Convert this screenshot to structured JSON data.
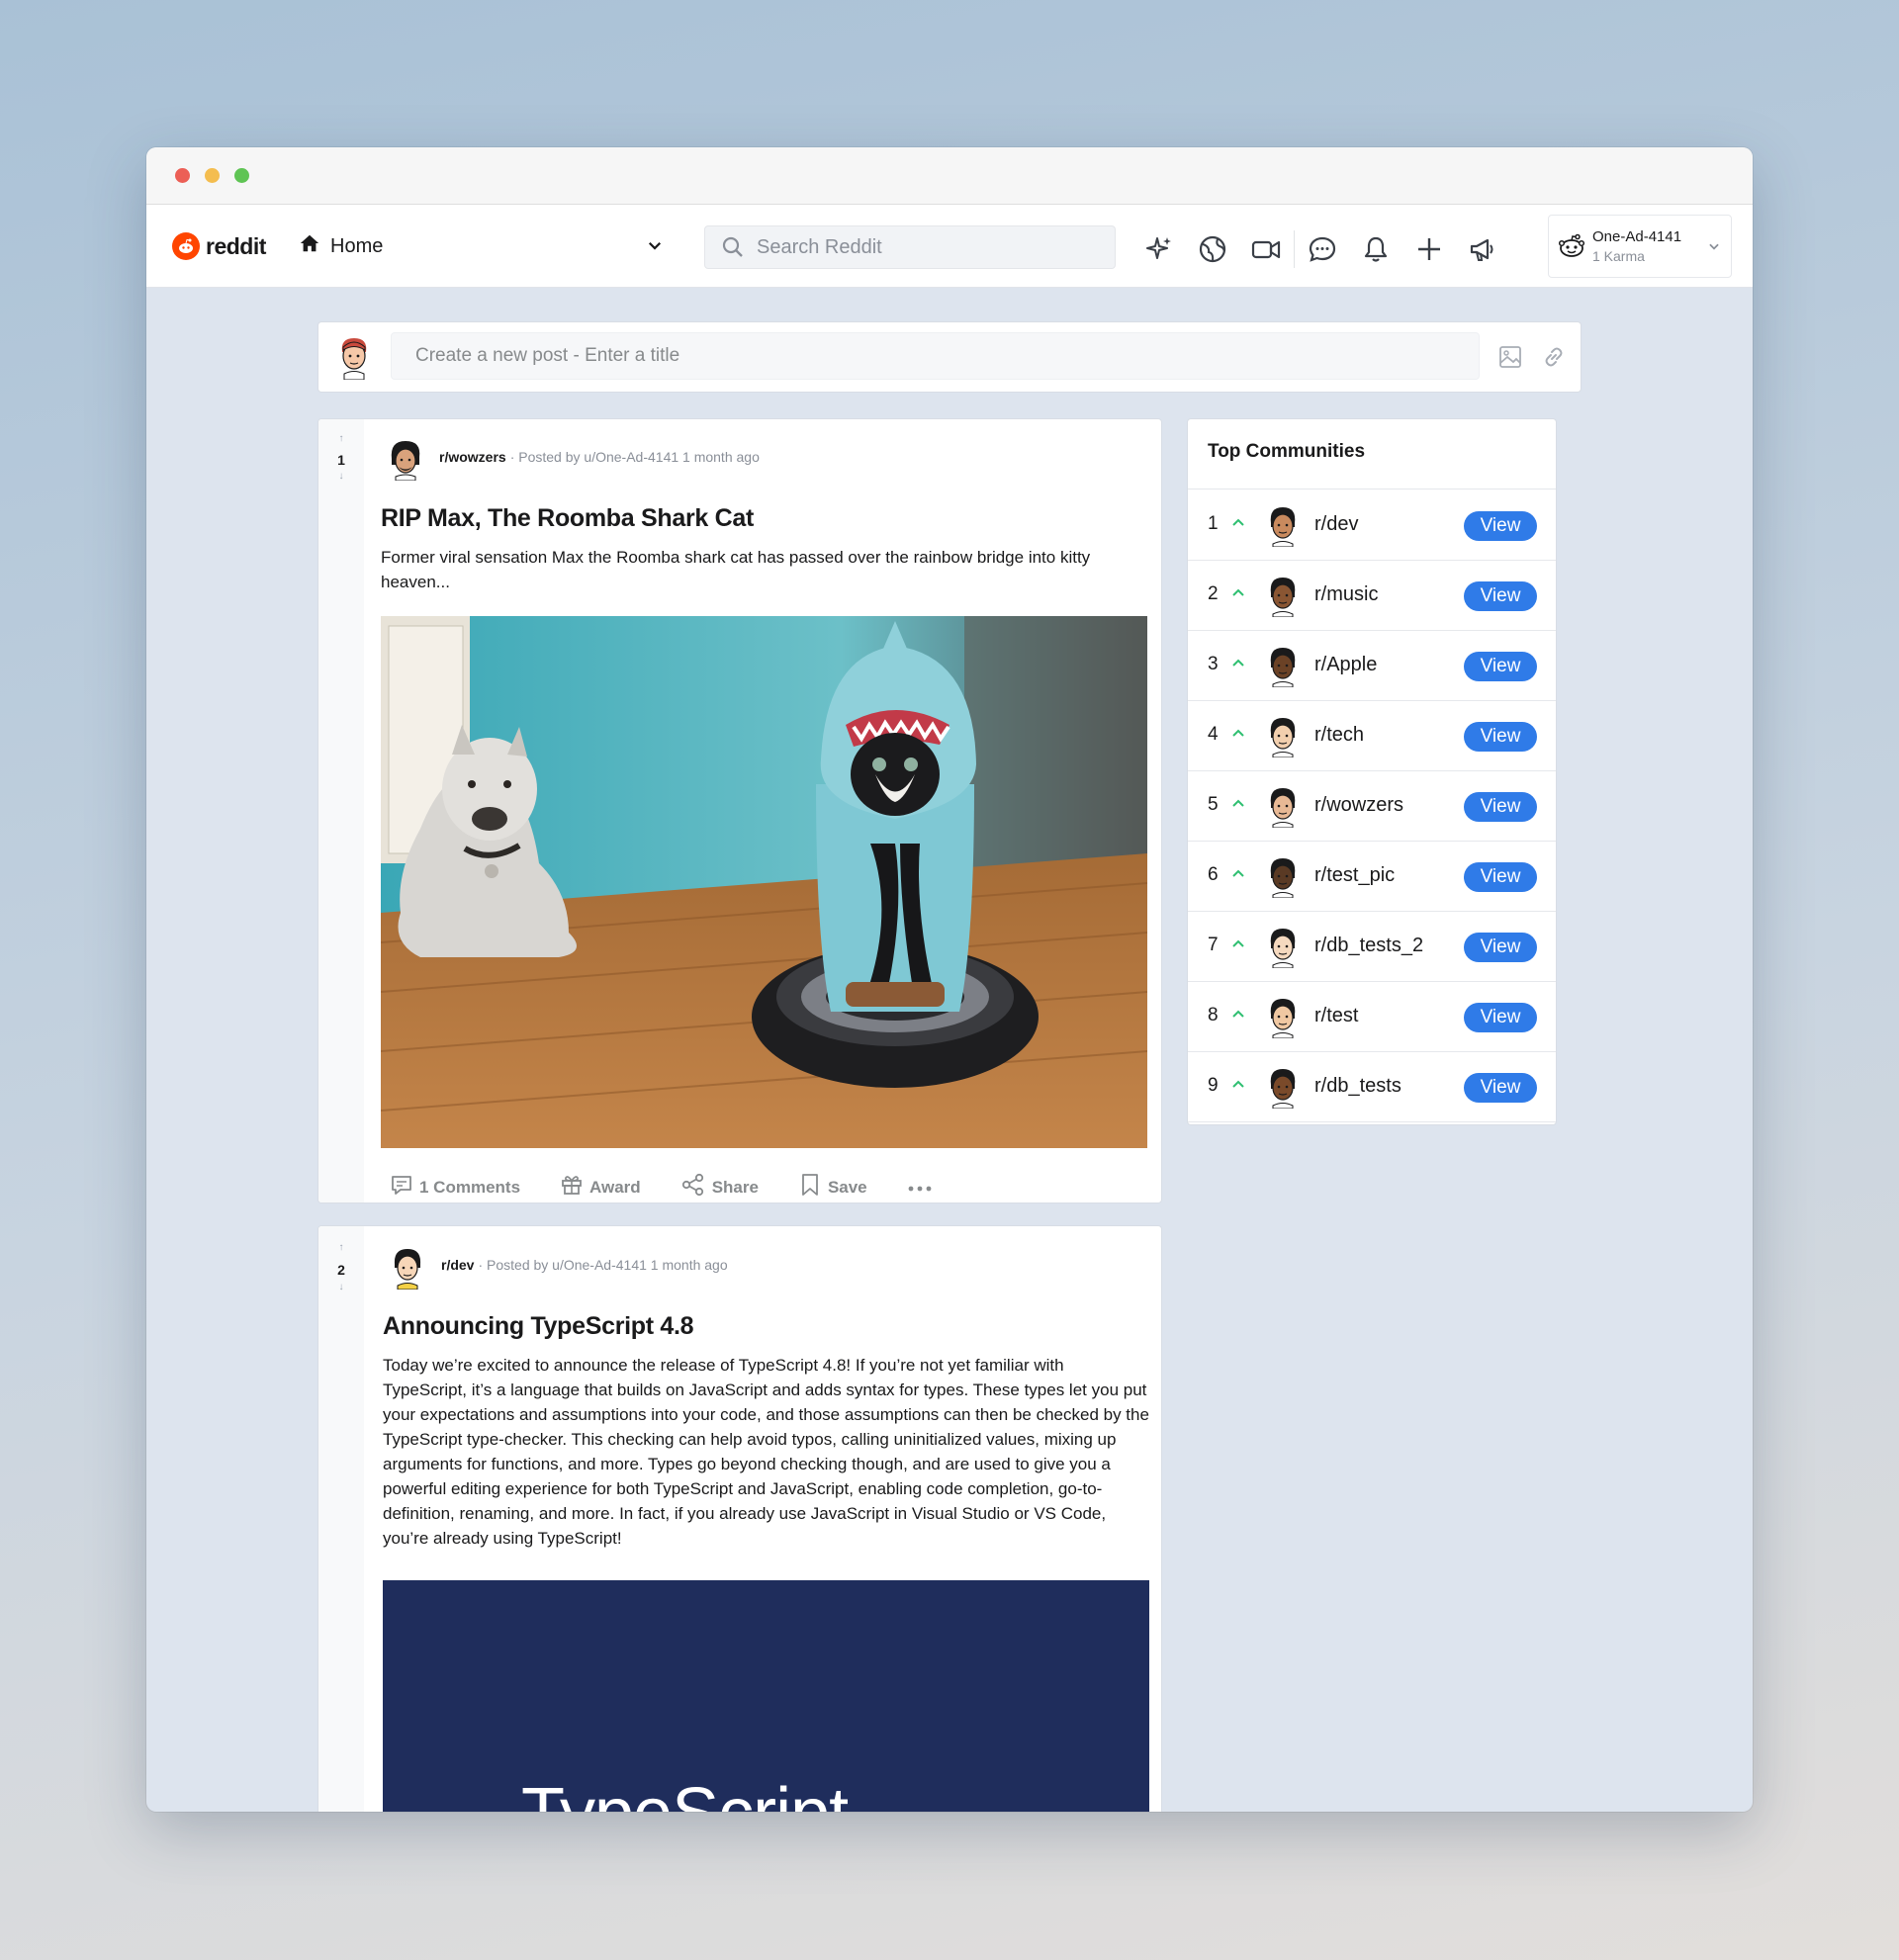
{
  "nav": {
    "logo_text": "reddit",
    "home_label": "Home",
    "search_placeholder": "Search Reddit",
    "user_name": "One-Ad-4141",
    "user_karma": "1 Karma"
  },
  "create_post": {
    "placeholder": "Create a new post - Enter a title"
  },
  "posts": [
    {
      "votes": "1",
      "subreddit": "r/wowzers",
      "posted_by": "· Posted by u/One-Ad-4141 1 month ago",
      "title": "RIP Max, The Roomba Shark Cat",
      "body": "Former viral sensation Max the Roomba shark cat has passed over the rainbow bridge into kitty heaven...",
      "comments_label": "1 Comments",
      "award_label": "Award",
      "share_label": "Share",
      "save_label": "Save"
    },
    {
      "votes": "2",
      "subreddit": "r/dev",
      "posted_by": "· Posted by u/One-Ad-4141 1 month ago",
      "title": "Announcing TypeScript 4.8",
      "body": "Today we’re excited to announce the release of TypeScript 4.8! If you’re not yet familiar with TypeScript, it’s a language that builds on JavaScript and adds syntax for types. These types let you put your expectations and assumptions into your code, and those assumptions can then be checked by the TypeScript type-checker. This checking can help avoid typos, calling uninitialized values, mixing up arguments for functions, and more. Types go beyond checking though, and are used to give you a powerful editing experience for both TypeScript and JavaScript, enabling code completion, go-to-definition, renaming, and more. In fact, if you already use JavaScript in Visual Studio or VS Code, you’re already using TypeScript!",
      "image_text": "TypeScript"
    }
  ],
  "sidebar": {
    "title": "Top Communities",
    "view_label": "View",
    "communities": [
      {
        "rank": "1",
        "name": "r/dev"
      },
      {
        "rank": "2",
        "name": "r/music"
      },
      {
        "rank": "3",
        "name": "r/Apple"
      },
      {
        "rank": "4",
        "name": "r/tech"
      },
      {
        "rank": "5",
        "name": "r/wowzers"
      },
      {
        "rank": "6",
        "name": "r/test_pic"
      },
      {
        "rank": "7",
        "name": "r/db_tests_2"
      },
      {
        "rank": "8",
        "name": "r/test"
      },
      {
        "rank": "9",
        "name": "r/db_tests"
      }
    ]
  },
  "colors": {
    "brand": "#ff4500",
    "accent": "#2f7be8",
    "upvote": "#2fbf71"
  },
  "icons": [
    "search-icon",
    "sparkle-icon",
    "globe-icon",
    "video-icon",
    "chat-icon",
    "bell-icon",
    "plus-icon",
    "megaphone-icon",
    "chevron-down-icon",
    "image-icon",
    "link-icon",
    "comment-icon",
    "gift-icon",
    "share-icon",
    "bookmark-icon",
    "more-icon"
  ]
}
